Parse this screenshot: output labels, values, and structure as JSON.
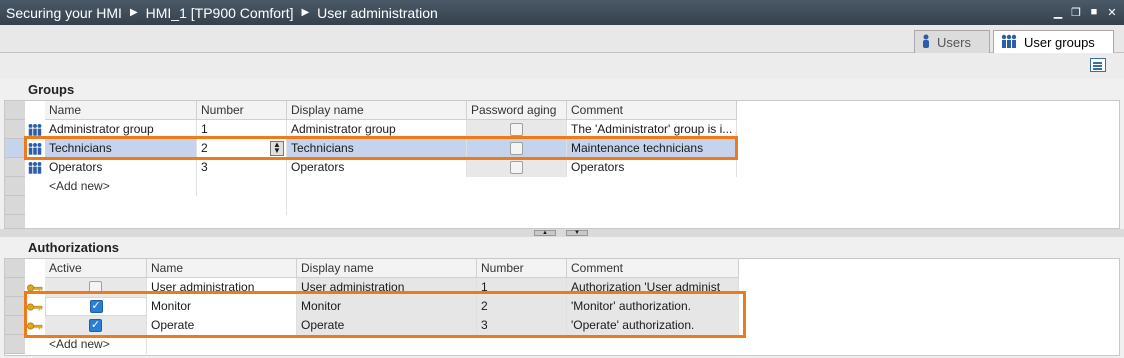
{
  "breadcrumb": [
    "Securing your HMI",
    "HMI_1 [TP900 Comfort]",
    "User administration"
  ],
  "window_buttons": [
    "minimize",
    "restore",
    "maximize",
    "close"
  ],
  "tabs": [
    {
      "label": "Users",
      "active": false
    },
    {
      "label": "User groups",
      "active": true
    }
  ],
  "groups": {
    "title": "Groups",
    "columns": [
      "Name",
      "Number",
      "Display name",
      "Password aging",
      "Comment"
    ],
    "rows": [
      {
        "name": "Administrator group",
        "number": "1",
        "display_name": "Administrator group",
        "password_aging": false,
        "comment": "The 'Administrator' group is i..."
      },
      {
        "name": "Technicians",
        "number": "2",
        "display_name": "Technicians",
        "password_aging": false,
        "comment": "Maintenance technicians"
      },
      {
        "name": "Operators",
        "number": "3",
        "display_name": "Operators",
        "password_aging": false,
        "comment": "Operators"
      }
    ],
    "add_new": "<Add new>"
  },
  "authorizations": {
    "title": "Authorizations",
    "columns": [
      "Active",
      "Name",
      "Display name",
      "Number",
      "Comment"
    ],
    "rows": [
      {
        "active": false,
        "name": "User administration",
        "display_name": "User administration",
        "number": "1",
        "comment": "Authorization 'User administ"
      },
      {
        "active": true,
        "name": "Monitor",
        "display_name": "Monitor",
        "number": "2",
        "comment": "'Monitor' authorization."
      },
      {
        "active": true,
        "name": "Operate",
        "display_name": "Operate",
        "number": "3",
        "comment": "'Operate' authorization."
      }
    ],
    "add_new": "<Add new>"
  },
  "colors": {
    "highlight": "#f07a1a",
    "selection": "#c5d4ec",
    "titlebar": "#3c4853"
  }
}
